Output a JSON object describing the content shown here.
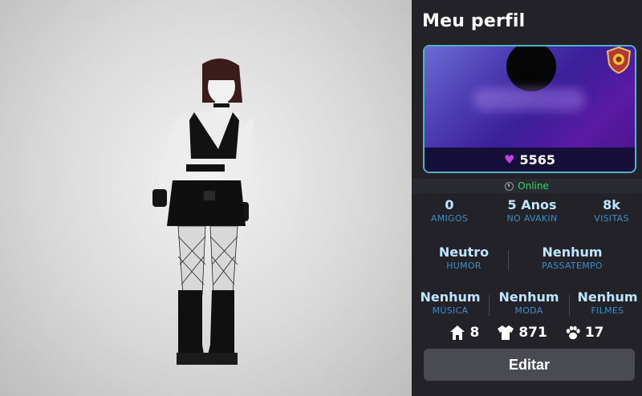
{
  "profile": {
    "title": "Meu perfil",
    "hearts": "5565",
    "status": "Online",
    "stats_row1": [
      {
        "value": "0",
        "label": "AMIGOS"
      },
      {
        "value": "5 Anos",
        "label": "NO AVAKIN"
      },
      {
        "value": "8k",
        "label": "VISITAS"
      }
    ],
    "stats_row2": [
      {
        "value": "Neutro",
        "label": "HUMOR"
      },
      {
        "value": "Nenhum",
        "label": "PASSATEMPO"
      }
    ],
    "stats_row3": [
      {
        "value": "Nenhum",
        "label": "MÚSICA"
      },
      {
        "value": "Nenhum",
        "label": "MODA"
      },
      {
        "value": "Nenhum",
        "label": "FILMES"
      }
    ],
    "counts": {
      "homes": "8",
      "outfits": "871",
      "pets": "17"
    },
    "edit_label": "Editar"
  },
  "colors": {
    "panel_bg": "#222228",
    "accent_border": "#4fb3c7",
    "value_text": "#bfe6ff",
    "label_text": "#3f8fc5",
    "online_green": "#36d56b",
    "heart_pink": "#c03ee8"
  },
  "icons": [
    "heart-icon",
    "clock-icon",
    "shield-badge-icon",
    "house-icon",
    "shirt-icon",
    "paw-icon"
  ]
}
